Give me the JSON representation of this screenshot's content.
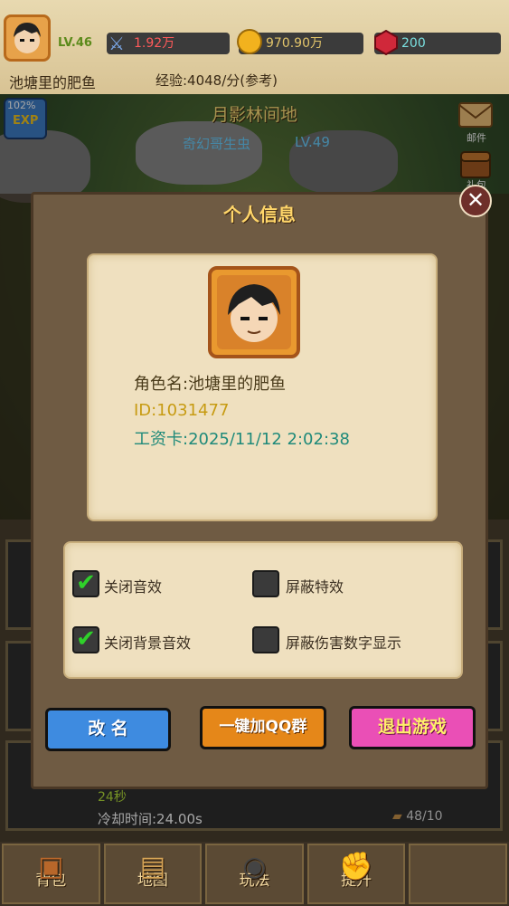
{
  "topbar": {
    "level": "LV.46",
    "power": "1.92万",
    "gold": "970.90万",
    "gems": "200",
    "player_name": "池塘里的肥鱼",
    "exp_rate": "经验:4048/分(参考)"
  },
  "map": {
    "name": "月影林间地",
    "boss": "奇幻哥生虫",
    "boss_level": "LV.49",
    "exp_badge": "102%",
    "exp_label": "EXP"
  },
  "side": {
    "mail_label": "邮件",
    "gift_label": "礼包"
  },
  "lower": {
    "seconds": "24秒",
    "cooldown": "冷却时间:24.00s",
    "counter": "48/10"
  },
  "modal": {
    "title": "个人信息",
    "role_name": "角色名:池塘里的肥鱼",
    "id": "ID:1031477",
    "salary_card": "工资卡:2025/11/12 2:02:38",
    "settings": [
      {
        "label": "关闭音效",
        "checked": true
      },
      {
        "label": "屏蔽特效",
        "checked": false
      },
      {
        "label": "关闭背景音效",
        "checked": true
      },
      {
        "label": "屏蔽伤害数字显示",
        "checked": false
      }
    ],
    "rename_button": "改 名",
    "qq_button": "一键加QQ群",
    "exit_button": "退出游戏",
    "colors": {
      "rename": "#3e8be0",
      "qq": "#e58719",
      "exit": "#ea4fb6"
    }
  },
  "bottom_nav": [
    {
      "label": "背包",
      "icon": "backpack-icon"
    },
    {
      "label": "地图",
      "icon": "map-scroll-icon"
    },
    {
      "label": "玩法",
      "icon": "gamepad-icon"
    },
    {
      "label": "提升",
      "icon": "fist-icon"
    },
    {
      "label": "",
      "icon": ""
    }
  ]
}
